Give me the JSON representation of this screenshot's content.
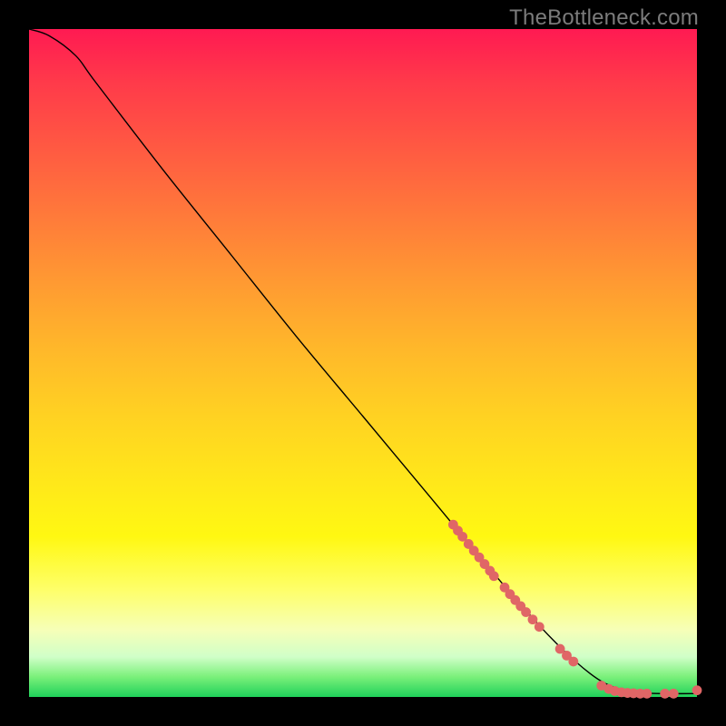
{
  "watermark": "TheBottleneck.com",
  "colors": {
    "dot_fill": "#e06666",
    "curve_stroke": "#000000",
    "background": "#000000"
  },
  "chart_data": {
    "type": "line",
    "title": "",
    "xlabel": "",
    "ylabel": "",
    "xlim": [
      0,
      100
    ],
    "ylim": [
      0,
      100
    ],
    "grid": false,
    "legend": false,
    "series": [
      {
        "name": "curve",
        "kind": "line",
        "x": [
          0,
          3,
          7,
          10,
          20,
          30,
          40,
          50,
          60,
          70,
          78,
          84,
          88,
          92,
          96,
          100
        ],
        "y": [
          100,
          99,
          96,
          92,
          79,
          66.5,
          54,
          42,
          30,
          18,
          9,
          3.5,
          1.3,
          0.6,
          0.5,
          0.5
        ]
      },
      {
        "name": "markers-upper-segment",
        "kind": "scatter",
        "x": [
          63.5,
          64.2,
          64.9,
          65.8,
          66.6,
          67.4,
          68.2,
          69.0,
          69.6
        ],
        "y": [
          25.8,
          24.9,
          24.0,
          22.9,
          21.9,
          20.9,
          19.9,
          18.9,
          18.1
        ]
      },
      {
        "name": "markers-lower-segment",
        "kind": "scatter",
        "x": [
          71.2,
          72.0,
          72.8,
          73.6,
          74.4,
          75.4,
          76.4
        ],
        "y": [
          16.4,
          15.4,
          14.5,
          13.6,
          12.7,
          11.6,
          10.5
        ]
      },
      {
        "name": "markers-elbow-cluster",
        "kind": "scatter",
        "x": [
          79.5,
          80.5,
          81.5
        ],
        "y": [
          7.2,
          6.2,
          5.3
        ]
      },
      {
        "name": "markers-floor-row",
        "kind": "scatter",
        "x": [
          85.7,
          86.8,
          87.7,
          88.7,
          89.6,
          90.5,
          91.5,
          92.5,
          95.2,
          96.5,
          100.0
        ],
        "y": [
          1.7,
          1.2,
          0.9,
          0.7,
          0.6,
          0.55,
          0.5,
          0.5,
          0.5,
          0.5,
          1.0
        ]
      }
    ]
  }
}
